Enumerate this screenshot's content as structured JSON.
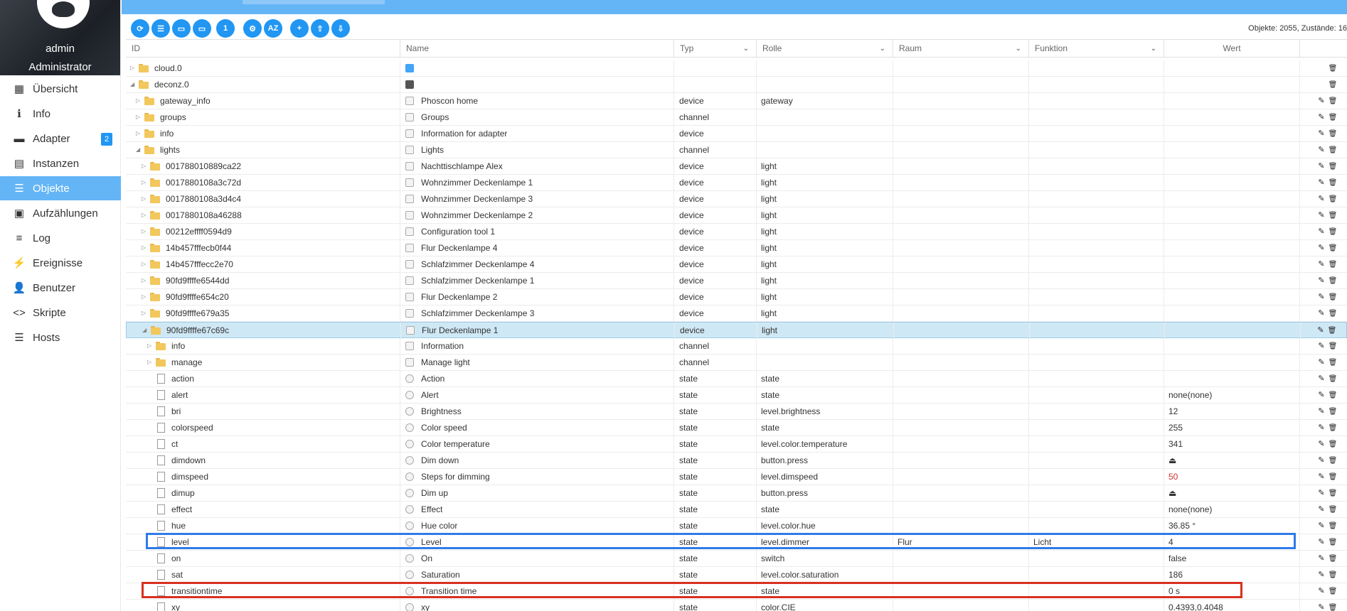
{
  "user": {
    "name": "admin",
    "role": "Administrator"
  },
  "nav": [
    {
      "label": "Übersicht",
      "icon": "grid-icon",
      "glyph": "▦"
    },
    {
      "label": "Info",
      "icon": "info-icon",
      "glyph": "ℹ"
    },
    {
      "label": "Adapter",
      "icon": "store-icon",
      "glyph": "▬",
      "badge": "2"
    },
    {
      "label": "Instanzen",
      "icon": "instances-icon",
      "glyph": "▤"
    },
    {
      "label": "Objekte",
      "icon": "list-icon",
      "glyph": "☰",
      "active": true
    },
    {
      "label": "Aufzählungen",
      "icon": "enum-icon",
      "glyph": "▣"
    },
    {
      "label": "Log",
      "icon": "log-icon",
      "glyph": "≡"
    },
    {
      "label": "Ereignisse",
      "icon": "flash-icon",
      "glyph": "⚡"
    },
    {
      "label": "Benutzer",
      "icon": "user-icon",
      "glyph": "👤"
    },
    {
      "label": "Skripte",
      "icon": "code-icon",
      "glyph": "<>"
    },
    {
      "label": "Hosts",
      "icon": "hosts-icon",
      "glyph": "☰"
    }
  ],
  "toolbar": {
    "buttons": [
      {
        "name": "refresh-button",
        "icon": "refresh-icon",
        "glyph": "⟳"
      },
      {
        "name": "list-view-button",
        "icon": "list-icon",
        "glyph": "☰"
      },
      {
        "name": "collapse-button",
        "icon": "folder-icon",
        "glyph": "▭"
      },
      {
        "name": "expand-button",
        "icon": "folder-open-icon",
        "glyph": "▭"
      },
      {
        "name": "level-button",
        "icon": "number-icon",
        "glyph": "1"
      },
      {
        "name": "admin-button",
        "icon": "person-gear-icon",
        "glyph": "⚙"
      },
      {
        "name": "sort-button",
        "icon": "sort-az-icon",
        "glyph": "AZ"
      },
      {
        "name": "add-button",
        "icon": "plus-icon",
        "glyph": "+"
      },
      {
        "name": "upload-button",
        "icon": "upload-icon",
        "glyph": "⇧"
      },
      {
        "name": "download-button",
        "icon": "download-icon",
        "glyph": "⇩"
      }
    ],
    "object_count": "Objekte: 2055, Zustände: 16"
  },
  "columns": {
    "id": "ID",
    "name": "Name",
    "type": "Typ",
    "role": "Rolle",
    "room": "Raum",
    "function": "Funktion",
    "value": "Wert"
  },
  "rows": [
    {
      "id": "cloud.0",
      "name": "",
      "icon": "cloud",
      "type": "",
      "role": "",
      "room": "",
      "func": "",
      "value": "",
      "level": 0,
      "kind": "folder",
      "exp": "closed",
      "edit": false
    },
    {
      "id": "deconz.0",
      "name": "",
      "icon": "dz",
      "type": "",
      "role": "",
      "room": "",
      "func": "",
      "value": "",
      "level": 0,
      "kind": "folder",
      "exp": "open",
      "edit": false
    },
    {
      "id": "gateway_info",
      "name": "Phoscon home",
      "icon": "box",
      "type": "device",
      "role": "gateway",
      "room": "",
      "func": "",
      "value": "",
      "level": 1,
      "kind": "folder",
      "exp": "closed",
      "edit": true
    },
    {
      "id": "groups",
      "name": "Groups",
      "icon": "box",
      "type": "channel",
      "role": "",
      "room": "",
      "func": "",
      "value": "",
      "level": 1,
      "kind": "folder",
      "exp": "closed",
      "edit": true
    },
    {
      "id": "info",
      "name": "Information for adapter",
      "icon": "box",
      "type": "device",
      "role": "",
      "room": "",
      "func": "",
      "value": "",
      "level": 1,
      "kind": "folder",
      "exp": "closed",
      "edit": true
    },
    {
      "id": "lights",
      "name": "Lights",
      "icon": "box",
      "type": "channel",
      "role": "",
      "room": "",
      "func": "",
      "value": "",
      "level": 1,
      "kind": "folder",
      "exp": "open",
      "edit": true
    },
    {
      "id": "001788010889ca22",
      "name": "Nachttischlampe Alex",
      "icon": "box",
      "type": "device",
      "role": "light",
      "room": "",
      "func": "",
      "value": "",
      "level": 2,
      "kind": "folder",
      "exp": "closed",
      "edit": true
    },
    {
      "id": "0017880108a3c72d",
      "name": "Wohnzimmer Deckenlampe 1",
      "icon": "box",
      "type": "device",
      "role": "light",
      "room": "",
      "func": "",
      "value": "",
      "level": 2,
      "kind": "folder",
      "exp": "closed",
      "edit": true
    },
    {
      "id": "0017880108a3d4c4",
      "name": "Wohnzimmer Deckenlampe 3",
      "icon": "box",
      "type": "device",
      "role": "light",
      "room": "",
      "func": "",
      "value": "",
      "level": 2,
      "kind": "folder",
      "exp": "closed",
      "edit": true
    },
    {
      "id": "0017880108a46288",
      "name": "Wohnzimmer Deckenlampe 2",
      "icon": "box",
      "type": "device",
      "role": "light",
      "room": "",
      "func": "",
      "value": "",
      "level": 2,
      "kind": "folder",
      "exp": "closed",
      "edit": true
    },
    {
      "id": "00212effff0594d9",
      "name": "Configuration tool 1",
      "icon": "box",
      "type": "device",
      "role": "light",
      "room": "",
      "func": "",
      "value": "",
      "level": 2,
      "kind": "folder",
      "exp": "closed",
      "edit": true
    },
    {
      "id": "14b457fffecb0f44",
      "name": "Flur Deckenlampe 4",
      "icon": "box",
      "type": "device",
      "role": "light",
      "room": "",
      "func": "",
      "value": "",
      "level": 2,
      "kind": "folder",
      "exp": "closed",
      "edit": true
    },
    {
      "id": "14b457fffecc2e70",
      "name": "Schlafzimmer Deckenlampe 4",
      "icon": "box",
      "type": "device",
      "role": "light",
      "room": "",
      "func": "",
      "value": "",
      "level": 2,
      "kind": "folder",
      "exp": "closed",
      "edit": true
    },
    {
      "id": "90fd9ffffe6544dd",
      "name": "Schlafzimmer Deckenlampe 1",
      "icon": "box",
      "type": "device",
      "role": "light",
      "room": "",
      "func": "",
      "value": "",
      "level": 2,
      "kind": "folder",
      "exp": "closed",
      "edit": true
    },
    {
      "id": "90fd9ffffe654c20",
      "name": "Flur Deckenlampe 2",
      "icon": "box",
      "type": "device",
      "role": "light",
      "room": "",
      "func": "",
      "value": "",
      "level": 2,
      "kind": "folder",
      "exp": "closed",
      "edit": true
    },
    {
      "id": "90fd9ffffe679a35",
      "name": "Schlafzimmer Deckenlampe 3",
      "icon": "box",
      "type": "device",
      "role": "light",
      "room": "",
      "func": "",
      "value": "",
      "level": 2,
      "kind": "folder",
      "exp": "closed",
      "edit": true
    },
    {
      "id": "90fd9ffffe67c69c",
      "name": "Flur Deckenlampe 1",
      "icon": "box",
      "type": "device",
      "role": "light",
      "room": "",
      "func": "",
      "value": "",
      "level": 2,
      "kind": "folder",
      "exp": "open",
      "edit": true,
      "selected": true
    },
    {
      "id": "info",
      "name": "Information",
      "icon": "box",
      "type": "channel",
      "role": "",
      "room": "",
      "func": "",
      "value": "",
      "level": 3,
      "kind": "folder",
      "exp": "closed",
      "edit": true
    },
    {
      "id": "manage",
      "name": "Manage light",
      "icon": "box",
      "type": "channel",
      "role": "",
      "room": "",
      "func": "",
      "value": "",
      "level": 3,
      "kind": "folder",
      "exp": "closed",
      "edit": true
    },
    {
      "id": "action",
      "name": "Action",
      "icon": "round",
      "type": "state",
      "role": "state",
      "room": "",
      "func": "",
      "value": "",
      "level": 3,
      "kind": "file",
      "edit": true
    },
    {
      "id": "alert",
      "name": "Alert",
      "icon": "round",
      "type": "state",
      "role": "state",
      "room": "",
      "func": "",
      "value": "none(none)",
      "level": 3,
      "kind": "file",
      "edit": true
    },
    {
      "id": "bri",
      "name": "Brightness",
      "icon": "round",
      "type": "state",
      "role": "level.brightness",
      "room": "",
      "func": "",
      "value": "12",
      "level": 3,
      "kind": "file",
      "edit": true
    },
    {
      "id": "colorspeed",
      "name": "Color speed",
      "icon": "round",
      "type": "state",
      "role": "state",
      "room": "",
      "func": "",
      "value": "255",
      "level": 3,
      "kind": "file",
      "edit": true
    },
    {
      "id": "ct",
      "name": "Color temperature",
      "icon": "round",
      "type": "state",
      "role": "level.color.temperature",
      "room": "",
      "func": "",
      "value": "341",
      "level": 3,
      "kind": "file",
      "edit": true
    },
    {
      "id": "dimdown",
      "name": "Dim down",
      "icon": "round",
      "type": "state",
      "role": "button.press",
      "room": "",
      "func": "",
      "value": "⏏",
      "level": 3,
      "kind": "file",
      "edit": true,
      "button": true
    },
    {
      "id": "dimspeed",
      "name": "Steps for dimming",
      "icon": "round",
      "type": "state",
      "role": "level.dimspeed",
      "room": "",
      "func": "",
      "value": "50",
      "level": 3,
      "kind": "file",
      "edit": true,
      "red": true
    },
    {
      "id": "dimup",
      "name": "Dim up",
      "icon": "round",
      "type": "state",
      "role": "button.press",
      "room": "",
      "func": "",
      "value": "⏏",
      "level": 3,
      "kind": "file",
      "edit": true,
      "button": true
    },
    {
      "id": "effect",
      "name": "Effect",
      "icon": "round",
      "type": "state",
      "role": "state",
      "room": "",
      "func": "",
      "value": "none(none)",
      "level": 3,
      "kind": "file",
      "edit": true
    },
    {
      "id": "hue",
      "name": "Hue color",
      "icon": "round",
      "type": "state",
      "role": "level.color.hue",
      "room": "",
      "func": "",
      "value": "36.85 °",
      "level": 3,
      "kind": "file",
      "edit": true
    },
    {
      "id": "level",
      "name": "Level",
      "icon": "round",
      "type": "state",
      "role": "level.dimmer",
      "room": "Flur",
      "func": "Licht",
      "value": "4",
      "level": 3,
      "kind": "file",
      "edit": true,
      "mark": "blue"
    },
    {
      "id": "on",
      "name": "On",
      "icon": "round",
      "type": "state",
      "role": "switch",
      "room": "",
      "func": "",
      "value": "false",
      "level": 3,
      "kind": "file",
      "edit": true
    },
    {
      "id": "sat",
      "name": "Saturation",
      "icon": "round",
      "type": "state",
      "role": "level.color.saturation",
      "room": "",
      "func": "",
      "value": "186",
      "level": 3,
      "kind": "file",
      "edit": true
    },
    {
      "id": "transitiontime",
      "name": "Transition time",
      "icon": "round",
      "type": "state",
      "role": "state",
      "room": "",
      "func": "",
      "value": "0 s",
      "level": 3,
      "kind": "file",
      "edit": true,
      "mark": "red"
    },
    {
      "id": "xy",
      "name": "xy",
      "icon": "round",
      "type": "state",
      "role": "color.CIE",
      "room": "",
      "func": "",
      "value": "0.4393,0.4048",
      "level": 3,
      "kind": "file",
      "edit": true
    }
  ],
  "colors": {
    "accent": "#64b5f6",
    "button": "#2196f3",
    "selected_row": "#cfe8f5",
    "mark_blue": "#2f7bea",
    "mark_red": "#d9301e"
  }
}
